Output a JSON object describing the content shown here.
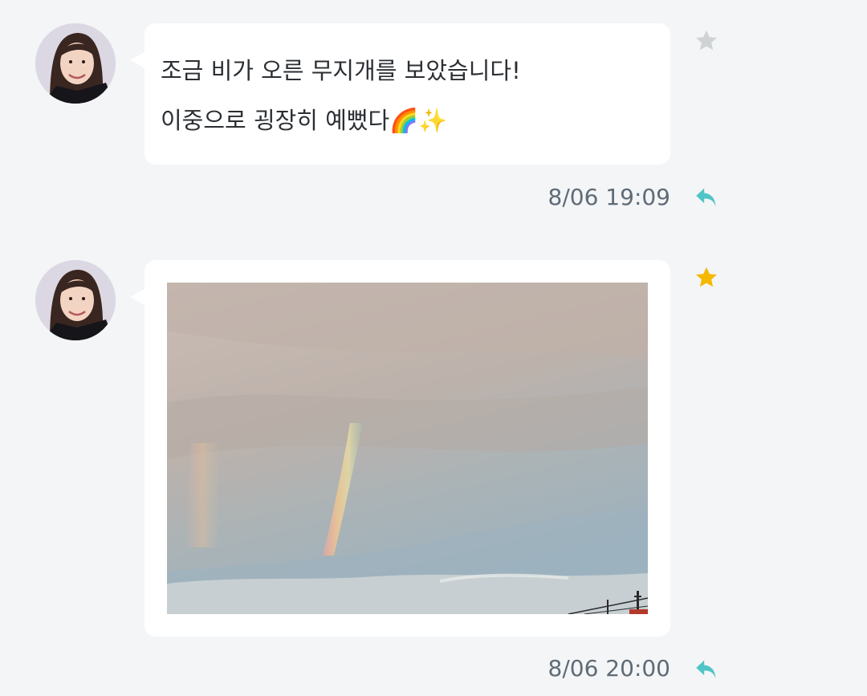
{
  "messages": [
    {
      "avatar_icon": "profile-photo",
      "lines": [
        "조금 비가 오른 무지개를 보았습니다!",
        "이중으로 굉장히 예뻤다🌈✨"
      ],
      "starred": false,
      "star_icon": "star-icon",
      "timestamp": "8/06 19:09",
      "reply_icon": "reply-icon"
    },
    {
      "avatar_icon": "profile-photo",
      "photo_icon": "rainbow-sky-photo",
      "starred": true,
      "star_icon": "star-icon",
      "timestamp": "8/06 20:00",
      "reply_icon": "reply-icon"
    }
  ],
  "colors": {
    "background": "#f3f5f7",
    "bubble": "#ffffff",
    "text": "#2b2f33",
    "timestamp": "#5f6b76",
    "reply_accent": "#4fc5c5",
    "star_active": "#f5b800",
    "star_inactive": "#d0d3d6"
  }
}
